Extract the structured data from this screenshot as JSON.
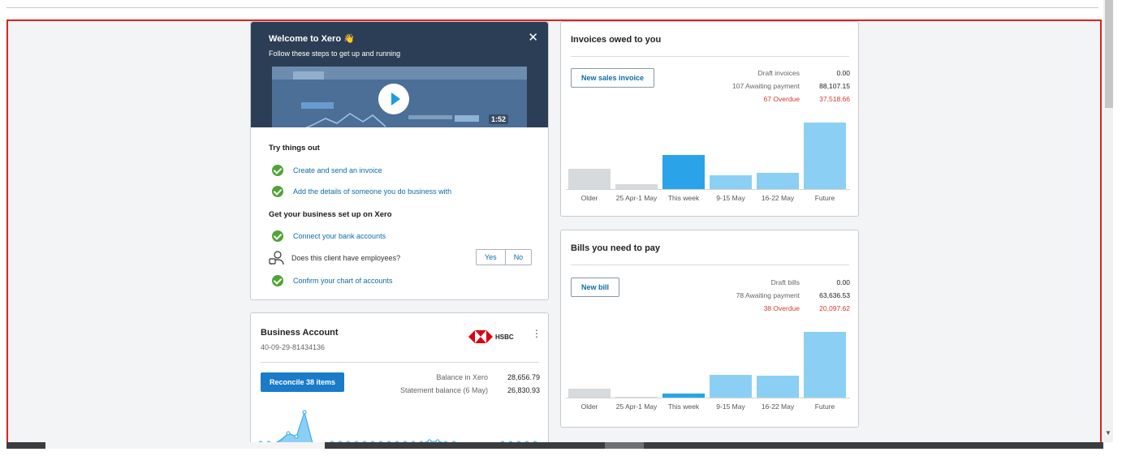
{
  "welcome": {
    "title": "Welcome to Xero",
    "emoji": "👋",
    "subtitle": "Follow these steps to get up and running",
    "close": "✕",
    "video_duration": "1:52",
    "try_heading": "Try things out",
    "try_steps": [
      "Create and send an invoice",
      "Add the details of someone you do business with"
    ],
    "setup_heading": "Get your business set up on Xero",
    "setup_bank": "Connect your bank accounts",
    "employees_question": "Does this client have employees?",
    "yes": "Yes",
    "no": "No",
    "setup_chart": "Confirm your chart of accounts"
  },
  "invoices": {
    "title": "Invoices owed to you",
    "button": "New sales invoice",
    "stats": [
      {
        "label": "Draft invoices",
        "value": "0.00",
        "overdue": false
      },
      {
        "label": "107 Awaiting payment",
        "value": "88,107.15",
        "overdue": false
      },
      {
        "label": "67 Overdue",
        "value": "37,518.66",
        "overdue": true
      }
    ]
  },
  "bills": {
    "title": "Bills you need to pay",
    "button": "New bill",
    "stats": [
      {
        "label": "Draft bills",
        "value": "0.00",
        "overdue": false
      },
      {
        "label": "78 Awaiting payment",
        "value": "63,636.53",
        "overdue": false
      },
      {
        "label": "38 Overdue",
        "value": "20,097.62",
        "overdue": true
      }
    ]
  },
  "chart_data": [
    {
      "type": "bar",
      "categories": [
        "Older",
        "25 Apr-1 May",
        "This week",
        "9-15 May",
        "16-22 May",
        "Future"
      ],
      "values": [
        25,
        6,
        42,
        17,
        20,
        82
      ],
      "colors": [
        "#d7dadd",
        "#d7dadd",
        "#2aa3e8",
        "#8bd0f4",
        "#8bd0f4",
        "#8bd0f4"
      ]
    },
    {
      "type": "bar",
      "categories": [
        "Older",
        "25 Apr-1 May",
        "This week",
        "9-15 May",
        "16-22 May",
        "Future"
      ],
      "values": [
        11,
        1,
        5,
        28,
        27,
        81
      ],
      "colors": [
        "#d7dadd",
        "#d7dadd",
        "#2aa3e8",
        "#8bd0f4",
        "#8bd0f4",
        "#8bd0f4"
      ]
    }
  ],
  "bank": {
    "name": "Business Account",
    "account_number": "40-09-29-81434136",
    "bank_name": "HSBC",
    "reconcile_button": "Reconcile 38 items",
    "balance_label": "Balance in Xero",
    "balance_value": "28,656.79",
    "statement_label": "Statement balance (6 May)",
    "statement_value": "26,830.93"
  },
  "colors": {
    "header_bg": "#2c3e55",
    "link": "#0b6ea8",
    "primary_button": "#1a7bc8",
    "overdue": "#d63b2f",
    "check": "#4ea435"
  }
}
